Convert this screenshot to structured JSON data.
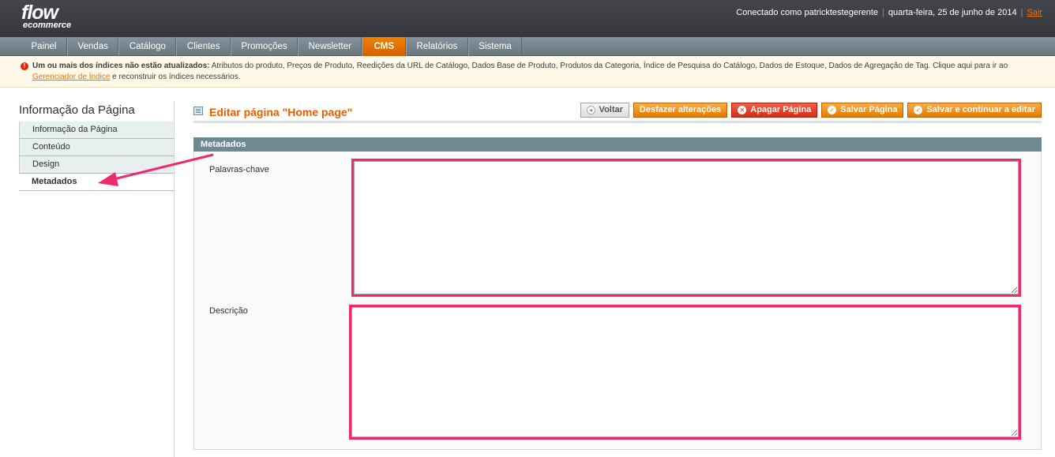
{
  "header": {
    "logo_main": "flow",
    "logo_sub": "ecommerce",
    "logged_in": "Conectado como patricktestegerente",
    "date": "quarta-feira, 25 de junho de 2014",
    "logout": "Sair"
  },
  "nav": {
    "items": [
      "Painel",
      "Vendas",
      "Catálogo",
      "Clientes",
      "Promoções",
      "Newsletter",
      "CMS",
      "Relatórios",
      "Sistema"
    ],
    "active": "CMS"
  },
  "notice": {
    "bold": "Um ou mais dos índices não estão atualizados:",
    "text": " Atributos do produto, Preços de Produto, Reedições da URL de Catálogo, Dados Base de Produto, Produtos da Categoria, Índice de Pesquisa do Catálogo, Dados de Estoque, Dados de Agregação de Tag. Clique aqui para ir ao ",
    "link": "Gerenciador de Índice",
    "text_after": " e reconstruir os índices necessários."
  },
  "sidebar": {
    "title": "Informação da Página",
    "tabs": [
      "Informação da Página",
      "Conteúdo",
      "Design",
      "Metadados"
    ],
    "active_tab": "Metadados"
  },
  "page": {
    "title": "Editar página \"Home page\"",
    "buttons": {
      "back": "Voltar",
      "reset": "Desfazer alterações",
      "delete": "Apagar Página",
      "save": "Salvar Página",
      "save_continue": "Salvar e continuar a editar"
    }
  },
  "fieldset": {
    "title": "Metadados",
    "keywords_label": "Palavras-chave",
    "keywords_value": "",
    "description_label": "Descrição",
    "description_value": ""
  },
  "colors": {
    "accent": "#ea7601",
    "highlight": "#ee2a6c",
    "fieldset_header": "#6f8992"
  }
}
